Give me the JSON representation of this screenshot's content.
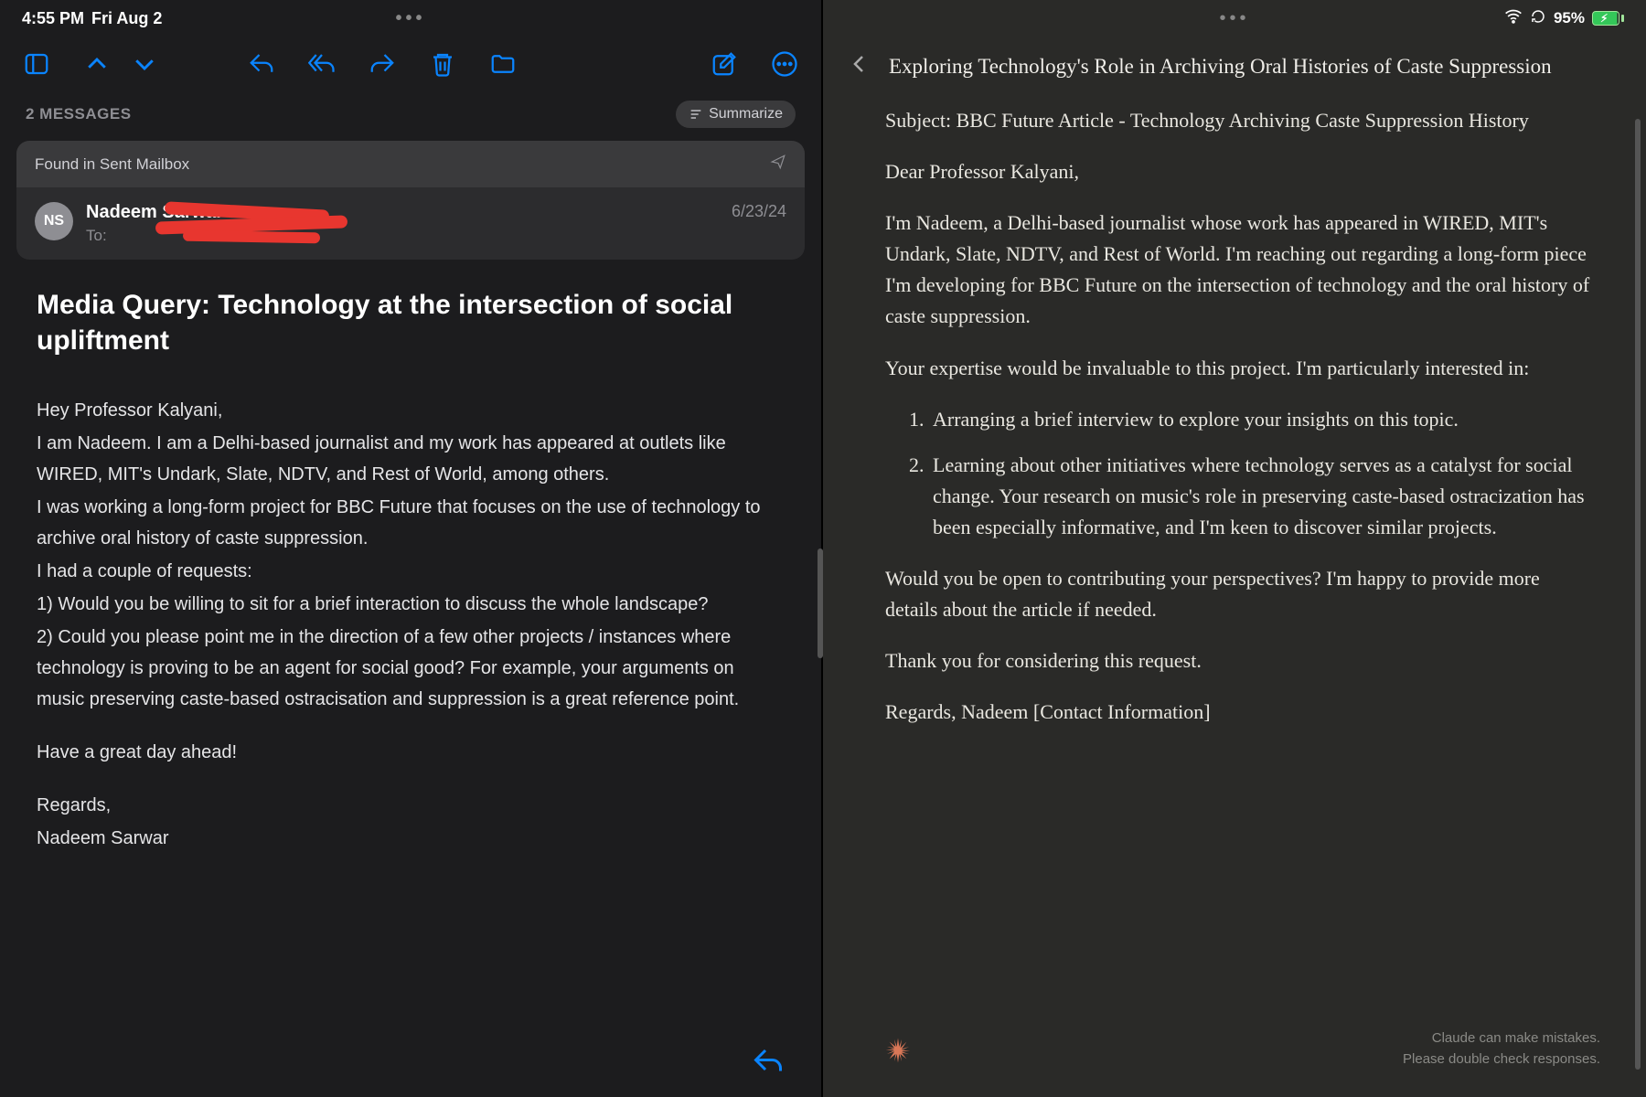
{
  "status": {
    "time": "4:55 PM",
    "date": "Fri Aug 2",
    "battery_pct": "95%"
  },
  "mail": {
    "messages_count_label": "2 MESSAGES",
    "summarize_label": "Summarize",
    "found_label": "Found in Sent Mailbox",
    "sender_initials": "NS",
    "sender_name": "Nadeem Sarwar",
    "to_label": "To:",
    "date": "6/23/24",
    "subject": "Media Query: Technology at the intersection of social upliftment",
    "body": {
      "p1": "Hey Professor Kalyani,",
      "p2": "I am Nadeem. I am a Delhi-based journalist and my work has appeared at outlets like WIRED, MIT's Undark, Slate, NDTV, and Rest of World, among others.",
      "p3": "I was working a long-form project for BBC Future that focuses on the use of technology to archive oral history of caste suppression.",
      "p4": "I had a couple of requests:",
      "p5": "1) Would you be willing to sit for a brief interaction to discuss the whole landscape?",
      "p6": "2) Could you please point me in the direction of a few other projects / instances where technology is proving to be an agent for social good? For example, your arguments on music preserving caste-based ostracisation and suppression is a great reference point.",
      "p7": "Have a great day ahead!",
      "p8": "Regards,",
      "p9": "Nadeem Sarwar"
    }
  },
  "claude": {
    "title": "Exploring Technology's Role in Archiving Oral Histories of Caste Suppression",
    "body": {
      "p1": "Subject: BBC Future Article - Technology Archiving Caste Suppression History",
      "p2": "Dear Professor Kalyani,",
      "p3": "I'm Nadeem, a Delhi-based journalist whose work has appeared in WIRED, MIT's Undark, Slate, NDTV, and Rest of World. I'm reaching out regarding a long-form piece I'm developing for BBC Future on the intersection of technology and the oral history of caste suppression.",
      "p4": "Your expertise would be invaluable to this project. I'm particularly interested in:",
      "li1": "Arranging a brief interview to explore your insights on this topic.",
      "li2": "Learning about other initiatives where technology serves as a catalyst for social change. Your research on music's role in preserving caste-based ostracization has been especially informative, and I'm keen to discover similar projects.",
      "p5": "Would you be open to contributing your perspectives? I'm happy to provide more details about the article if needed.",
      "p6": "Thank you for considering this request.",
      "p7": "Regards, Nadeem [Contact Information]"
    },
    "disclaimer_1": "Claude can make mistakes.",
    "disclaimer_2": "Please double check responses."
  }
}
